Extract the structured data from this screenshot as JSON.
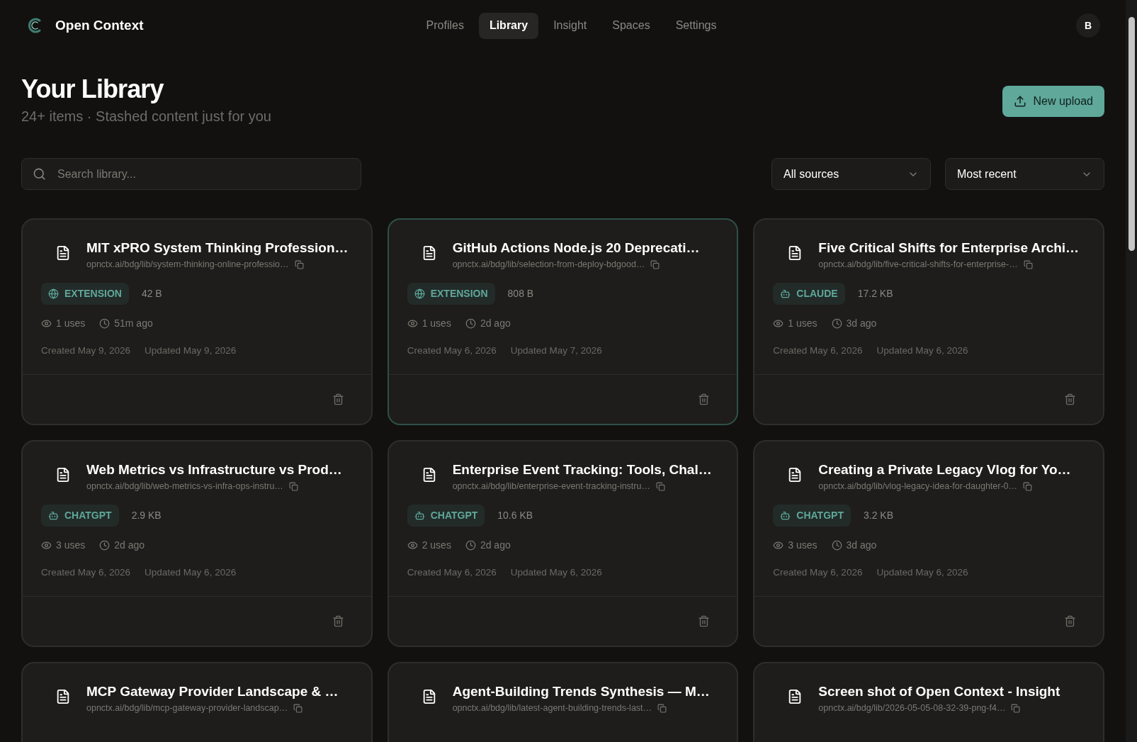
{
  "app": {
    "name": "Open Context"
  },
  "nav": [
    {
      "label": "Profiles",
      "selected": false
    },
    {
      "label": "Library",
      "selected": true
    },
    {
      "label": "Insight",
      "selected": false
    },
    {
      "label": "Spaces",
      "selected": false
    },
    {
      "label": "Settings",
      "selected": false
    }
  ],
  "avatar": "B",
  "header": {
    "title": "Your Library",
    "subtitle": "24+ items · Stashed content just for you",
    "upload_button": "New upload"
  },
  "search": {
    "placeholder": "Search library..."
  },
  "filters": [
    {
      "value": "All sources"
    },
    {
      "value": "Most recent"
    }
  ],
  "cards": [
    {
      "title": "MIT xPRO System Thinking Profession…",
      "url": "opnctx.ai/bdg/lib/system-thinking-online-professio…",
      "source": {
        "label": "EXTENSION",
        "kind": "web"
      },
      "size": "42 B",
      "uses": "1 uses",
      "age": "51m ago",
      "created": "Created May 9, 2026",
      "updated": "Updated May 9, 2026",
      "highlighted": false
    },
    {
      "title": "GitHub Actions Node.js 20 Deprecati…",
      "url": "opnctx.ai/bdg/lib/selection-from-deploy-bdgood…",
      "source": {
        "label": "EXTENSION",
        "kind": "web"
      },
      "size": "808 B",
      "uses": "1 uses",
      "age": "2d ago",
      "created": "Created May 6, 2026",
      "updated": "Updated May 7, 2026",
      "highlighted": true
    },
    {
      "title": "Five Critical Shifts for Enterprise Archi…",
      "url": "opnctx.ai/bdg/lib/five-critical-shifts-for-enterprise-…",
      "source": {
        "label": "CLAUDE",
        "kind": "bot"
      },
      "size": "17.2 KB",
      "uses": "1 uses",
      "age": "3d ago",
      "created": "Created May 6, 2026",
      "updated": "Updated May 6, 2026",
      "highlighted": false
    },
    {
      "title": "Web Metrics vs Infrastructure vs Prod…",
      "url": "opnctx.ai/bdg/lib/web-metrics-vs-infra-ops-instru…",
      "source": {
        "label": "CHATGPT",
        "kind": "bot"
      },
      "size": "2.9 KB",
      "uses": "3 uses",
      "age": "2d ago",
      "created": "Created May 6, 2026",
      "updated": "Updated May 6, 2026",
      "highlighted": false
    },
    {
      "title": "Enterprise Event Tracking: Tools, Chal…",
      "url": "opnctx.ai/bdg/lib/enterprise-event-tracking-instru…",
      "source": {
        "label": "CHATGPT",
        "kind": "bot"
      },
      "size": "10.6 KB",
      "uses": "2 uses",
      "age": "2d ago",
      "created": "Created May 6, 2026",
      "updated": "Updated May 6, 2026",
      "highlighted": false
    },
    {
      "title": "Creating a Private Legacy Vlog for Yo…",
      "url": "opnctx.ai/bdg/lib/vlog-legacy-idea-for-daughter-0…",
      "source": {
        "label": "CHATGPT",
        "kind": "bot"
      },
      "size": "3.2 KB",
      "uses": "3 uses",
      "age": "3d ago",
      "created": "Created May 6, 2026",
      "updated": "Updated May 6, 2026",
      "highlighted": false
    },
    {
      "title": "MCP Gateway Provider Landscape & …",
      "url": "opnctx.ai/bdg/lib/mcp-gateway-provider-landscap…",
      "highlighted": false
    },
    {
      "title": "Agent-Building Trends Synthesis — M…",
      "url": "opnctx.ai/bdg/lib/latest-agent-building-trends-last…",
      "highlighted": false
    },
    {
      "title": "Screen shot of Open Context - Insight",
      "url": "opnctx.ai/bdg/lib/2026-05-05-08-32-39-png-f4…",
      "highlighted": false
    }
  ]
}
